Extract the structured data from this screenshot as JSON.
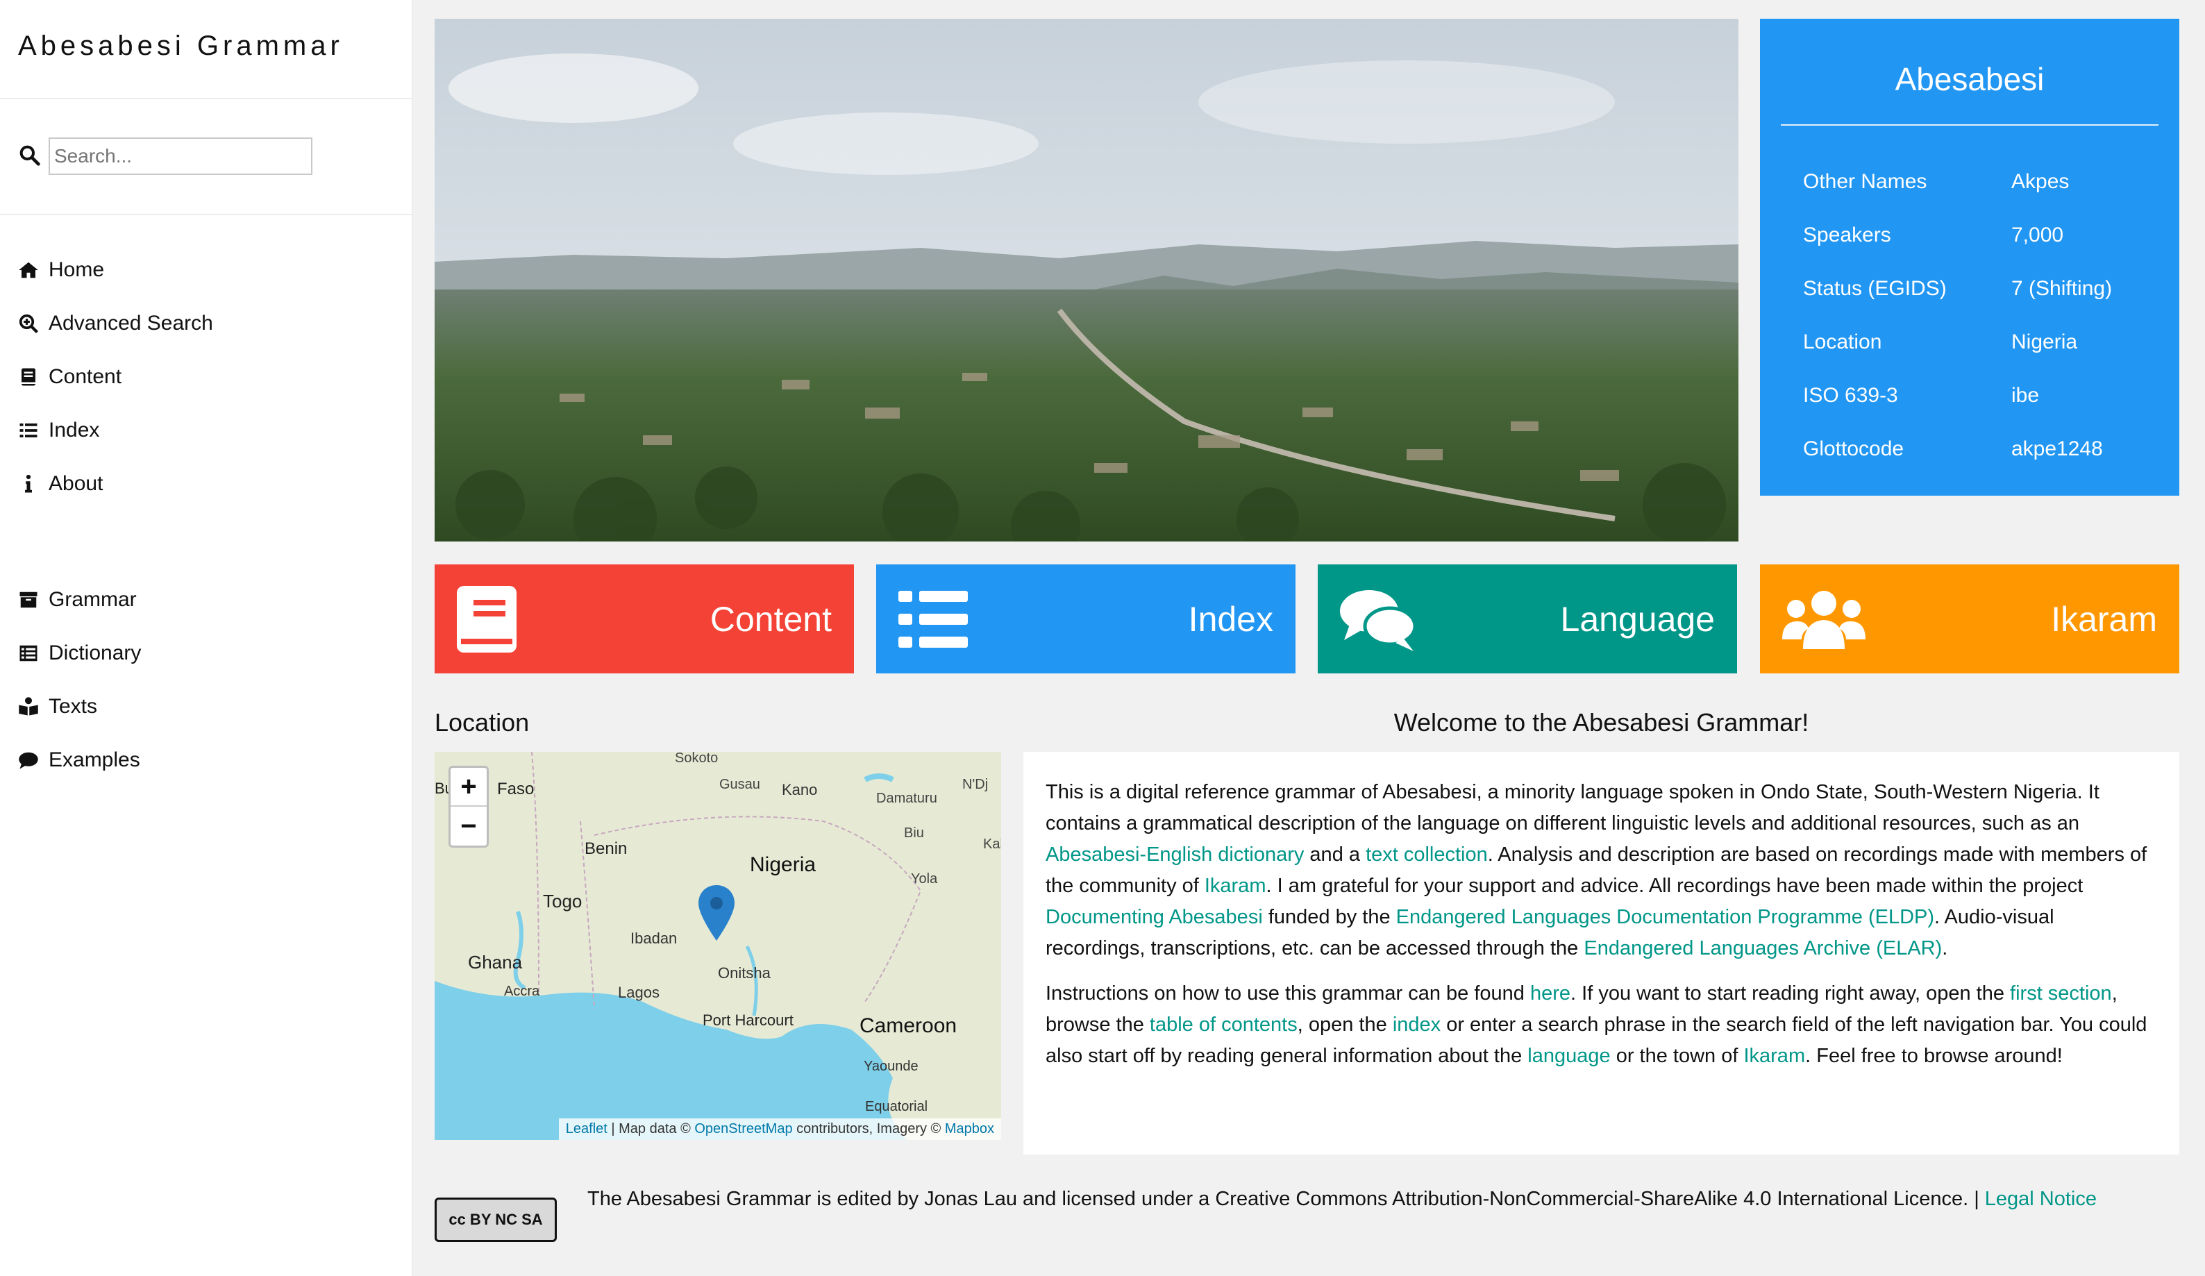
{
  "sidebar": {
    "brand": "Abesabesi Grammar",
    "search_placeholder": "Search...",
    "nav_top": [
      {
        "label": "Home",
        "icon": "home-icon"
      },
      {
        "label": "Advanced Search",
        "icon": "zoom-search-icon"
      },
      {
        "label": "Content",
        "icon": "book-icon"
      },
      {
        "label": "Index",
        "icon": "list-icon"
      },
      {
        "label": "About",
        "icon": "info-icon"
      }
    ],
    "nav_bottom": [
      {
        "label": "Grammar",
        "icon": "archive-icon"
      },
      {
        "label": "Dictionary",
        "icon": "table-list-icon"
      },
      {
        "label": "Texts",
        "icon": "book-reader-icon"
      },
      {
        "label": "Examples",
        "icon": "comment-icon"
      }
    ]
  },
  "infobox": {
    "title": "Abesabesi",
    "rows": [
      {
        "key": "Other Names",
        "value": "Akpes"
      },
      {
        "key": "Speakers",
        "value": "7,000"
      },
      {
        "key": "Status (EGIDS)",
        "value": "7 (Shifting)"
      },
      {
        "key": "Location",
        "value": "Nigeria"
      },
      {
        "key": "ISO 639-3",
        "value": "ibe"
      },
      {
        "key": "Glottocode",
        "value": "akpe1248"
      }
    ],
    "color": "#2196f3"
  },
  "tiles": [
    {
      "label": "Content",
      "color": "#f44336",
      "icon": "book-icon"
    },
    {
      "label": "Index",
      "color": "#2196f3",
      "icon": "list-icon"
    },
    {
      "label": "Language",
      "color": "#009688",
      "icon": "comments-icon"
    },
    {
      "label": "Ikaram",
      "color": "#ff9800",
      "icon": "users-icon"
    }
  ],
  "location": {
    "title": "Location",
    "map_labels": [
      "Sokoto",
      "Gusau",
      "Kano",
      "Damaturu",
      "N'Dj",
      "Faso",
      "Benin",
      "Nigeria",
      "Biu",
      "Kal",
      "Togo",
      "Yola",
      "Ibadan",
      "Ghana",
      "Onitsha",
      "Accra",
      "Lagos",
      "Port Harcourt",
      "Cameroon",
      "Yaounde",
      "Equatorial",
      "Bu"
    ],
    "zoom_in": "+",
    "zoom_out": "−",
    "attribution": {
      "leaflet": "Leaflet",
      "mid": " | Map data © ",
      "osm": "OpenStreetMap",
      "mid2": " contributors, Imagery © ",
      "mapbox": "Mapbox"
    }
  },
  "welcome": {
    "title": "Welcome to the Abesabesi Grammar!",
    "p1": [
      {
        "t": "This is a digital reference grammar of Abesabesi, a minority language spoken in Ondo State, South-Western Nigeria. It contains a grammatical description of the language on different linguistic levels and additional resources, such as an "
      },
      {
        "t": "Abesabesi-English dictionary",
        "link": true
      },
      {
        "t": " and a "
      },
      {
        "t": "text collection",
        "link": true
      },
      {
        "t": ". Analysis and description are based on recordings made with members of the community of "
      },
      {
        "t": "Ikaram",
        "link": true
      },
      {
        "t": ". I am grateful for your support and advice. All recordings have been made within the project "
      },
      {
        "t": "Documenting Abesabesi",
        "link": true
      },
      {
        "t": " funded by the "
      },
      {
        "t": "Endangered Languages Documentation Programme (ELDP)",
        "link": true
      },
      {
        "t": ". Audio-visual recordings, transcriptions, etc. can be accessed through the "
      },
      {
        "t": "Endangered Languages Archive (ELAR)",
        "link": true
      },
      {
        "t": "."
      }
    ],
    "p2": [
      {
        "t": "Instructions on how to use this grammar can be found "
      },
      {
        "t": "here",
        "link": true
      },
      {
        "t": ". If you want to start reading right away, open the "
      },
      {
        "t": "first section",
        "link": true
      },
      {
        "t": ", browse the "
      },
      {
        "t": "table of contents",
        "link": true
      },
      {
        "t": ", open the "
      },
      {
        "t": "index",
        "link": true
      },
      {
        "t": " or enter a search phrase in the search field of the left navigation bar. You could also start off by reading general information about the "
      },
      {
        "t": "language",
        "link": true
      },
      {
        "t": " or the town of "
      },
      {
        "t": "Ikaram",
        "link": true
      },
      {
        "t": ". Feel free to browse around!"
      }
    ]
  },
  "footer": {
    "cc_badge": "cc BY NC SA",
    "text": "The Abesabesi Grammar is edited by Jonas Lau and licensed under a Creative Commons Attribution-NonCommercial-ShareAlike 4.0 International Licence. | ",
    "link": "Legal Notice"
  },
  "colors": {
    "link": "#009688",
    "accent": "#2196f3"
  }
}
